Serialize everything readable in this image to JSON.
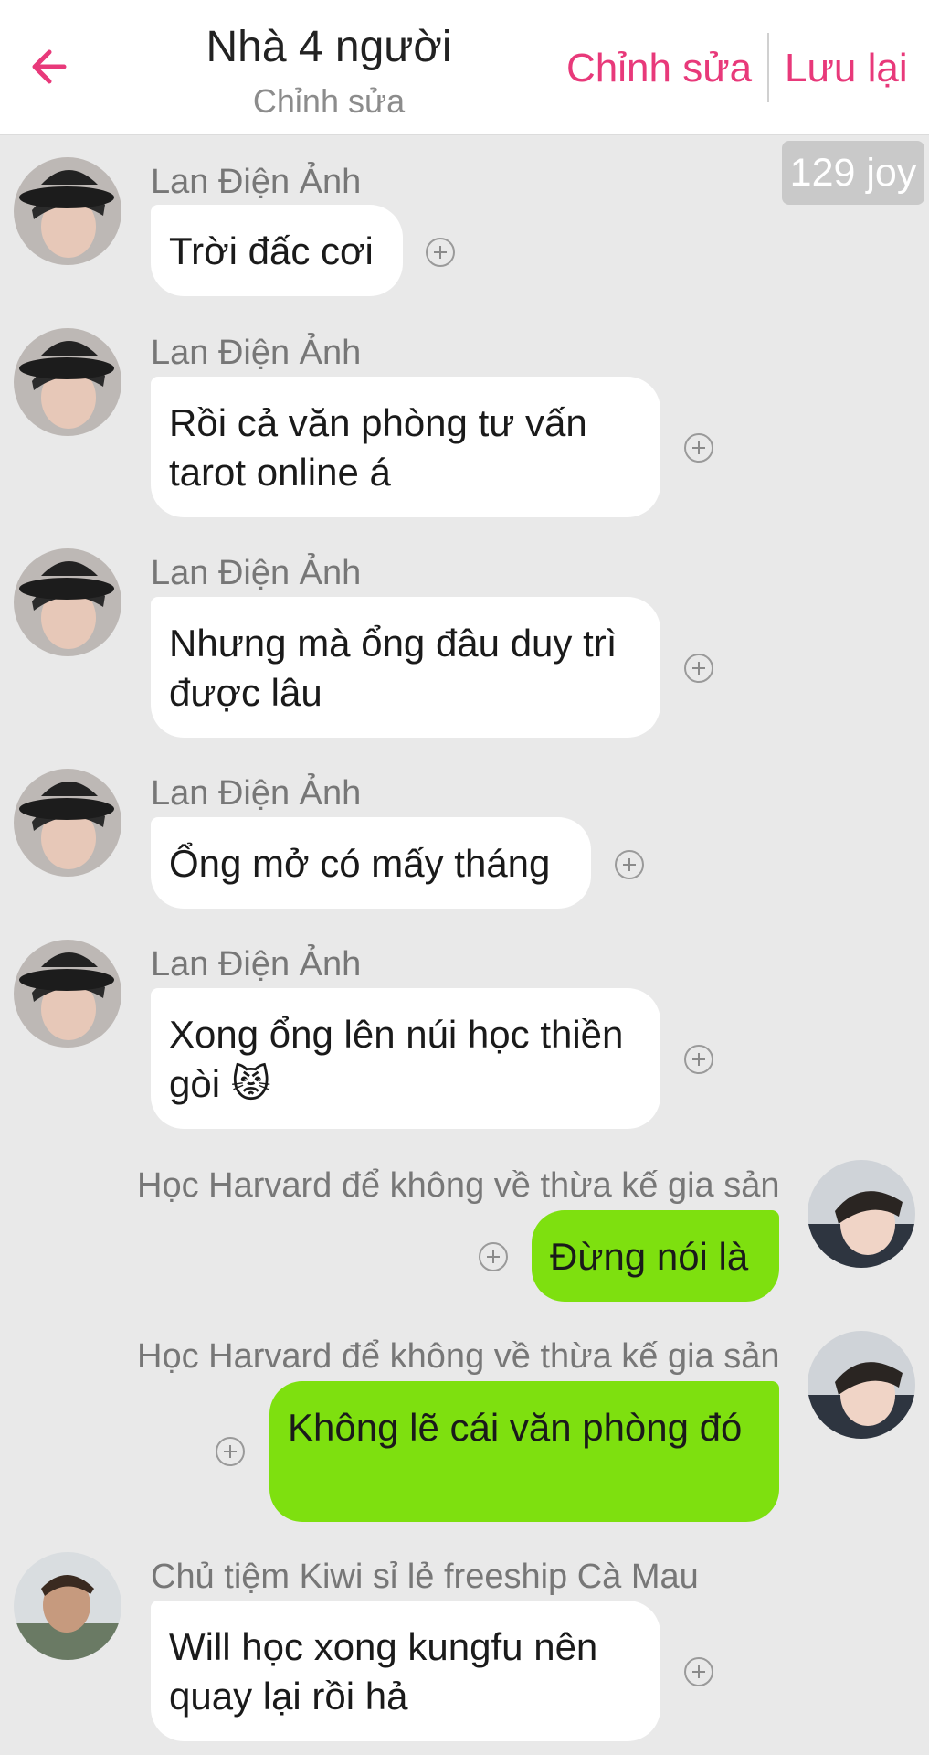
{
  "header": {
    "title": "Nhà 4 người",
    "subtitle": "Chỉnh sửa",
    "edit_label": "Chỉnh sửa",
    "save_label": "Lưu lại"
  },
  "joy_badge": "129 joy",
  "colors": {
    "accent": "#e8397a",
    "outgoing_bubble": "#7ee00f",
    "incoming_bubble": "#ffffff",
    "chat_background": "#e9e9e9"
  },
  "messages": [
    {
      "sender": "Lan Điện Ảnh",
      "text": "Trời đấc cơi",
      "direction": "incoming"
    },
    {
      "sender": "Lan Điện Ảnh",
      "text": "Rồi cả văn phòng tư vấn tarot online á",
      "direction": "incoming"
    },
    {
      "sender": "Lan Điện Ảnh",
      "text": "Nhưng mà ổng đâu duy trì được lâu",
      "direction": "incoming"
    },
    {
      "sender": "Lan Điện Ảnh",
      "text": "Ổng mở có mấy tháng",
      "direction": "incoming"
    },
    {
      "sender": "Lan Điện Ảnh",
      "text": "Xong ổng lên núi học thiền gòi 😾",
      "direction": "incoming"
    },
    {
      "sender": "Học Harvard để không về thừa kế gia sản",
      "text": "Đừng nói là",
      "direction": "outgoing"
    },
    {
      "sender": "Học Harvard để không về thừa kế gia sản",
      "text": "Không lẽ cái văn phòng đó",
      "direction": "outgoing"
    },
    {
      "sender": "Chủ tiệm Kiwi sỉ lẻ freeship Cà Mau",
      "text": "Will học xong kungfu nên quay lại rồi hả",
      "direction": "incoming"
    }
  ]
}
